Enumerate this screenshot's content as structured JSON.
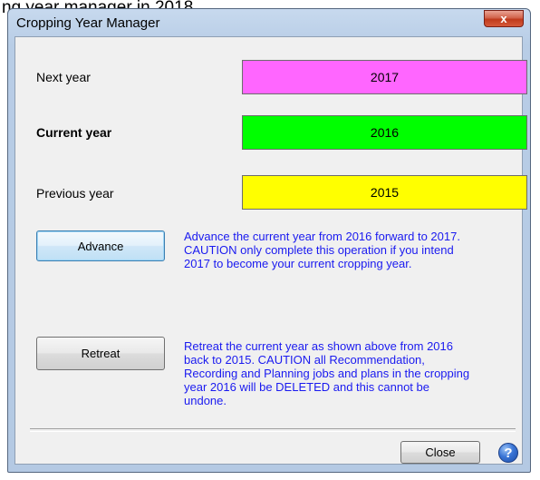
{
  "background": {
    "partial_title": "ng year manager in 2018"
  },
  "window": {
    "title": "Cropping Year Manager",
    "close_glyph": "x"
  },
  "years": {
    "next": {
      "label": "Next year",
      "value": "2017",
      "color": "#ff66ff"
    },
    "current": {
      "label": "Current year",
      "value": "2016",
      "color": "#00ff00"
    },
    "previous": {
      "label": "Previous year",
      "value": "2015",
      "color": "#ffff00"
    }
  },
  "advance": {
    "button_label": "Advance",
    "description": "Advance the current year from 2016 forward to 2017.\nCAUTION only complete this operation if you intend\n2017 to become your current cropping year."
  },
  "retreat": {
    "button_label": "Retreat",
    "description": "Retreat the current year as shown above from 2016\nback to 2015.  CAUTION all Recommendation,\nRecording and Planning jobs and plans in the cropping\nyear 2016 will be DELETED and this cannot be\nundone."
  },
  "footer": {
    "close_label": "Close",
    "help_glyph": "?"
  }
}
